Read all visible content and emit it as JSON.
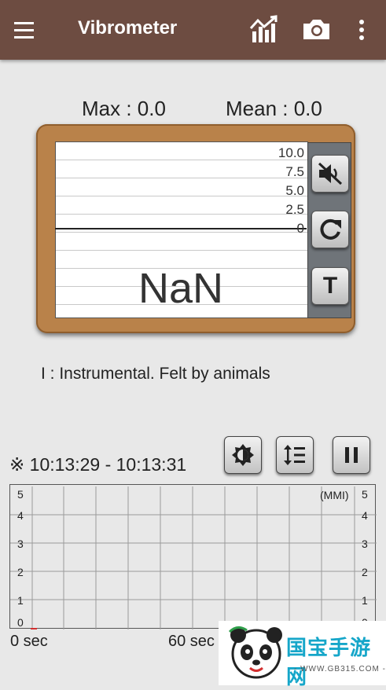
{
  "appbar": {
    "title": "Vibrometer",
    "icons": [
      "menu-icon",
      "chart-icon",
      "camera-icon",
      "more-vert-icon"
    ]
  },
  "stats": {
    "max": "Max : 0.0",
    "mean": "Mean : 0.0"
  },
  "gauge": {
    "scale": [
      "10.0",
      "7.5",
      "5.0",
      "2.5",
      "0"
    ],
    "reading": "NaN",
    "side_buttons": [
      "mute-icon",
      "refresh-icon",
      "text-icon"
    ],
    "text_button_label": "T"
  },
  "intensity": {
    "text": "I   : Instrumental. Felt by animals"
  },
  "graph": {
    "time_range": "※ 10:13:29 - 10:13:31",
    "controls": [
      "brightness-icon",
      "line-spacing-icon",
      "pause-icon"
    ],
    "y_ticks": [
      "5",
      "4",
      "3",
      "2",
      "1",
      "0"
    ],
    "unit": "(MMI)",
    "x_labels": [
      "0 sec",
      "60 sec"
    ]
  },
  "watermark": {
    "brand": "国宝手游网",
    "url": "- WWW.GB315.COM -"
  },
  "colors": {
    "appbar": "#6d4c41",
    "board": "#b9824a",
    "watermark_text": "#15a6c9"
  }
}
